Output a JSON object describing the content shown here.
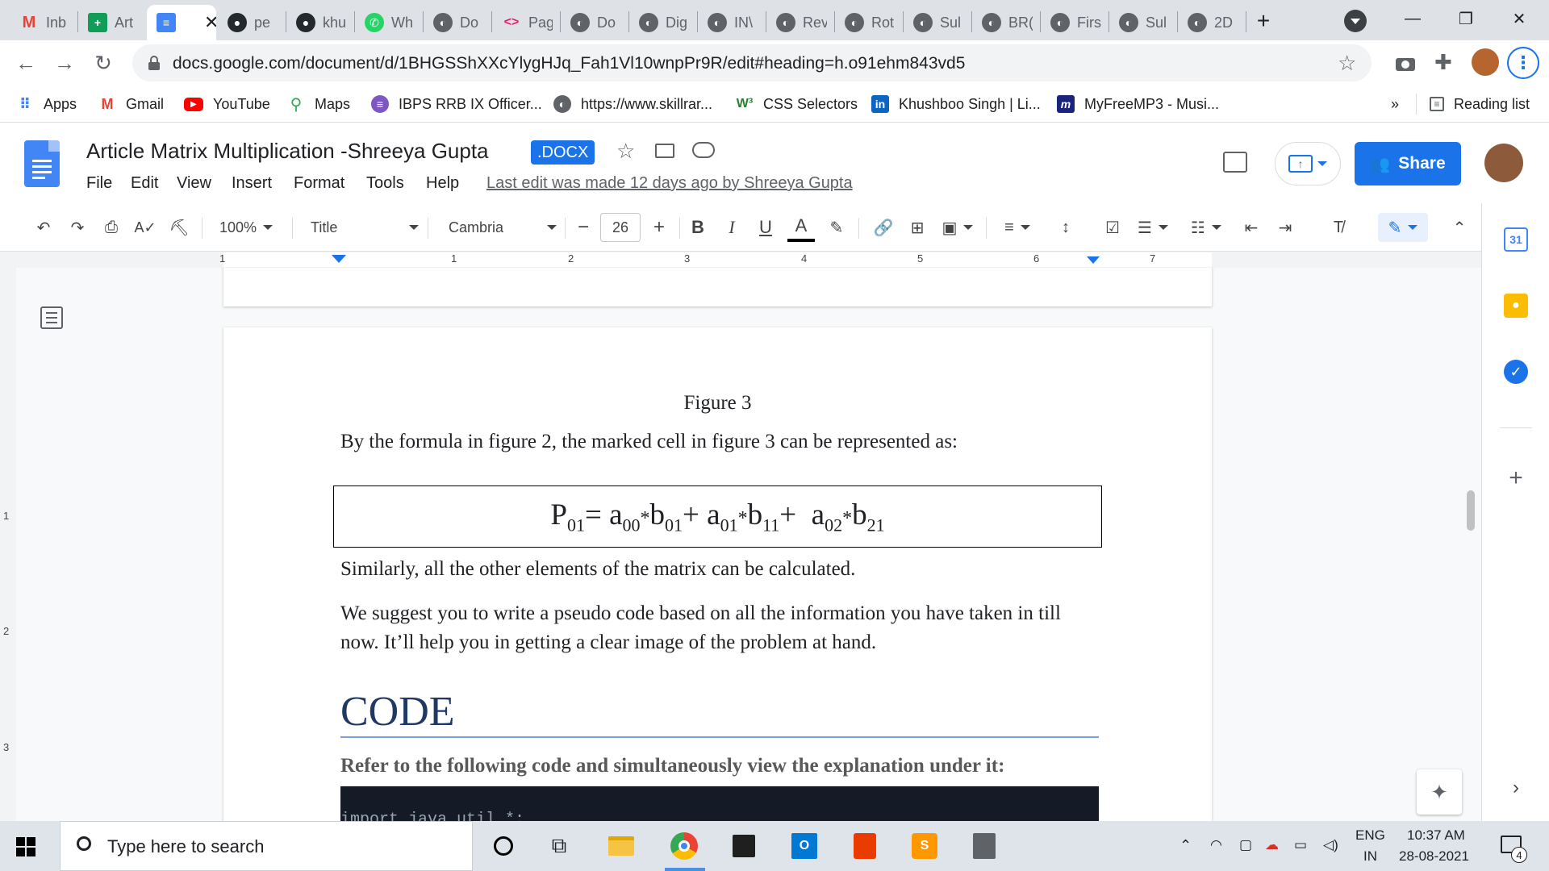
{
  "browser": {
    "tabs": [
      {
        "label": "Inb",
        "icon": "gmail-icon",
        "color": "#ea4335"
      },
      {
        "label": "Art",
        "icon": "sheets-icon",
        "color": "#0f9d58"
      },
      {
        "label": "Article Matrix Multiplication -Shreeya Gupta",
        "icon": "docs-icon",
        "color": "#4285f4",
        "active": true
      },
      {
        "label": "pe",
        "icon": "github-icon",
        "color": "#24292e"
      },
      {
        "label": "khu",
        "icon": "github-icon",
        "color": "#24292e"
      },
      {
        "label": "Wh",
        "icon": "whatsapp-icon",
        "color": "#25d366"
      },
      {
        "label": "Do",
        "icon": "globe-icon",
        "color": "#5f6368"
      },
      {
        "label": "Pag",
        "icon": "code-icon",
        "color": "#5f6368"
      },
      {
        "label": "Do",
        "icon": "globe-icon",
        "color": "#5f6368"
      },
      {
        "label": "Dig",
        "icon": "globe-icon",
        "color": "#5f6368"
      },
      {
        "label": "IN\\",
        "icon": "globe-icon",
        "color": "#5f6368"
      },
      {
        "label": "Rev",
        "icon": "globe-icon",
        "color": "#5f6368"
      },
      {
        "label": "Rot",
        "icon": "globe-icon",
        "color": "#5f6368"
      },
      {
        "label": "Sul",
        "icon": "globe-icon",
        "color": "#5f6368"
      },
      {
        "label": "BR(",
        "icon": "globe-icon",
        "color": "#5f6368"
      },
      {
        "label": "Firs",
        "icon": "globe-icon",
        "color": "#5f6368"
      },
      {
        "label": "Sul",
        "icon": "globe-icon",
        "color": "#5f6368"
      },
      {
        "label": "2D",
        "icon": "globe-icon",
        "color": "#5f6368"
      }
    ],
    "new_tab": "+",
    "url": "docs.google.com/document/d/1BHGSShXXcYlygHJq_Fah1Vl10wnpPr9R/edit#heading=h.o91ehm843vd5",
    "bookmarks": [
      {
        "label": "Apps",
        "icon": "apps-grid-icon"
      },
      {
        "label": "Gmail",
        "icon": "gmail-icon"
      },
      {
        "label": "YouTube",
        "icon": "youtube-icon"
      },
      {
        "label": "Maps",
        "icon": "maps-pin-icon"
      },
      {
        "label": "IBPS RRB IX Officer...",
        "icon": "site-icon"
      },
      {
        "label": "https://www.skillrar...",
        "icon": "globe-icon"
      },
      {
        "label": "CSS Selectors",
        "icon": "w3-icon"
      },
      {
        "label": "Khushboo Singh | Li...",
        "icon": "linkedin-icon"
      },
      {
        "label": "MyFreeMP3 - Musi...",
        "icon": "myfreemp3-icon"
      }
    ],
    "more_bookmarks": "»",
    "reading_list": "Reading list"
  },
  "docs": {
    "title": "Article Matrix Multiplication -Shreeya Gupta",
    "format_badge": ".DOCX",
    "menus": [
      "File",
      "Edit",
      "View",
      "Insert",
      "Format",
      "Tools",
      "Help"
    ],
    "last_edit": "Last edit was made 12 days ago by Shreeya Gupta",
    "share_label": "Share",
    "toolbar": {
      "zoom": "100%",
      "style": "Title",
      "font": "Cambria",
      "font_size": "26",
      "bold": "B",
      "italic": "I",
      "underline": "U",
      "text_color": "A"
    },
    "ruler_numbers": [
      "1",
      "1",
      "2",
      "3",
      "4",
      "5",
      "6",
      "7"
    ],
    "vruler_numbers": [
      "1",
      "2",
      "3"
    ]
  },
  "document": {
    "figure_caption": "Figure 3",
    "para1": "By the formula in figure 2, the marked cell in figure 3 can be represented as:",
    "formula": {
      "lhs": "P",
      "lhs_sub": "01",
      "terms": [
        {
          "a": "a",
          "a_sub": "00",
          "b": "b",
          "b_sub": "01"
        },
        {
          "a": "a",
          "a_sub": "01",
          "b": "b",
          "b_sub": "11"
        },
        {
          "a": "a",
          "a_sub": "02",
          "b": "b",
          "b_sub": "21"
        }
      ],
      "eq": "=",
      "plus": "+",
      "times": "*"
    },
    "para2": "Similarly, all the other elements of the matrix can be calculated.",
    "para3": "We suggest you to write a pseudo code based on all the information you have taken in till now. It’ll help you in getting a clear image of the problem at hand.",
    "heading": "CODE",
    "refer": "Refer to the following code and simultaneously view the explanation under it:",
    "code_line": "import java.util.*;"
  },
  "taskbar": {
    "search_placeholder": "Type here to search",
    "language": "ENG",
    "region": "IN",
    "time": "10:37 AM",
    "date": "28-08-2021",
    "notification_count": "4"
  }
}
